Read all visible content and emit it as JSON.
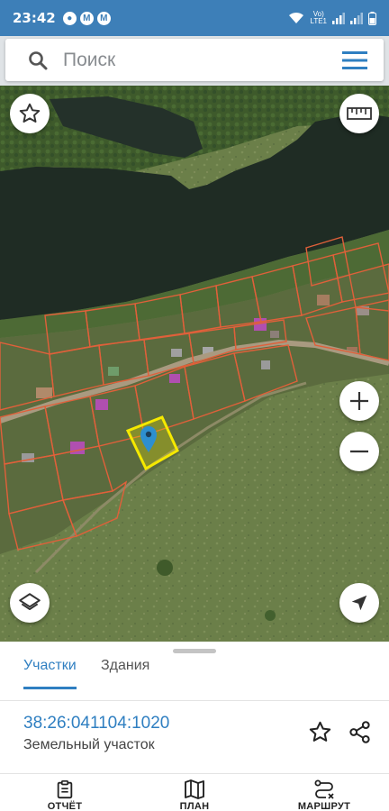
{
  "status_bar": {
    "time": "23:42",
    "notification_icons": [
      "m-icon",
      "m-icon",
      "m-icon"
    ],
    "network_label_top": "Vo)",
    "network_label_bottom": "LTE1"
  },
  "search": {
    "placeholder": "Поиск"
  },
  "map": {
    "type": "satellite-cadastral",
    "parcel_border_color": "#e0603a",
    "selected_parcel_color": "#f5e900",
    "marker_color": "#2e8fcf",
    "controls": [
      "star-icon",
      "ruler-icon",
      "zoom-in-icon",
      "zoom-out-icon",
      "layers-icon",
      "location-arrow-icon"
    ]
  },
  "sheet": {
    "tabs": [
      {
        "label": "Участки",
        "active": true
      },
      {
        "label": "Здания",
        "active": false
      }
    ],
    "parcel": {
      "number": "38:26:041104:1020",
      "type": "Земельный участок"
    },
    "accent_color": "#2f7fc1"
  },
  "bottom_nav": [
    {
      "label": "ОТЧЁТ",
      "icon": "clipboard-icon"
    },
    {
      "label": "ПЛАН",
      "icon": "map-icon"
    },
    {
      "label": "МАРШРУТ",
      "icon": "route-icon"
    }
  ]
}
